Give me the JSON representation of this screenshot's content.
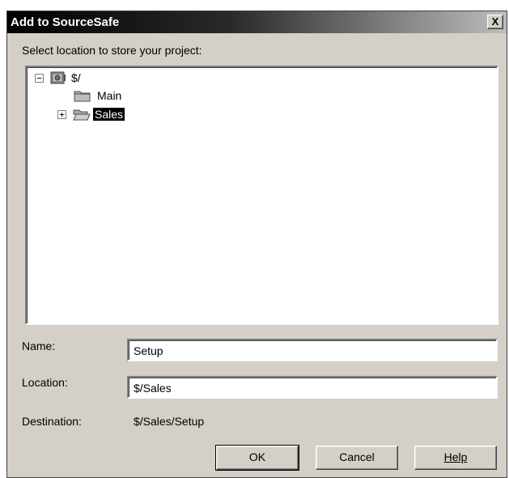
{
  "dialog": {
    "title": "Add to SourceSafe",
    "close_glyph": "X",
    "prompt": "Select location to store your project:"
  },
  "tree": {
    "root": {
      "label": "$/",
      "expander": "−",
      "icon": "database-safe-icon"
    },
    "children": [
      {
        "label": "Main",
        "icon": "folder-closed-icon",
        "expander": ""
      },
      {
        "label": "Sales",
        "icon": "folder-open-icon",
        "expander": "+",
        "selected": true
      }
    ]
  },
  "fields": {
    "name_label": "Name:",
    "name_value": "Setup",
    "location_label": "Location:",
    "location_value": "$/Sales",
    "destination_label": "Destination:",
    "destination_value": "$/Sales/Setup"
  },
  "buttons": {
    "ok": "OK",
    "cancel": "Cancel",
    "help": "Help"
  },
  "colors": {
    "dialog_bg": "#d4d0c8",
    "selection": "#000000"
  }
}
